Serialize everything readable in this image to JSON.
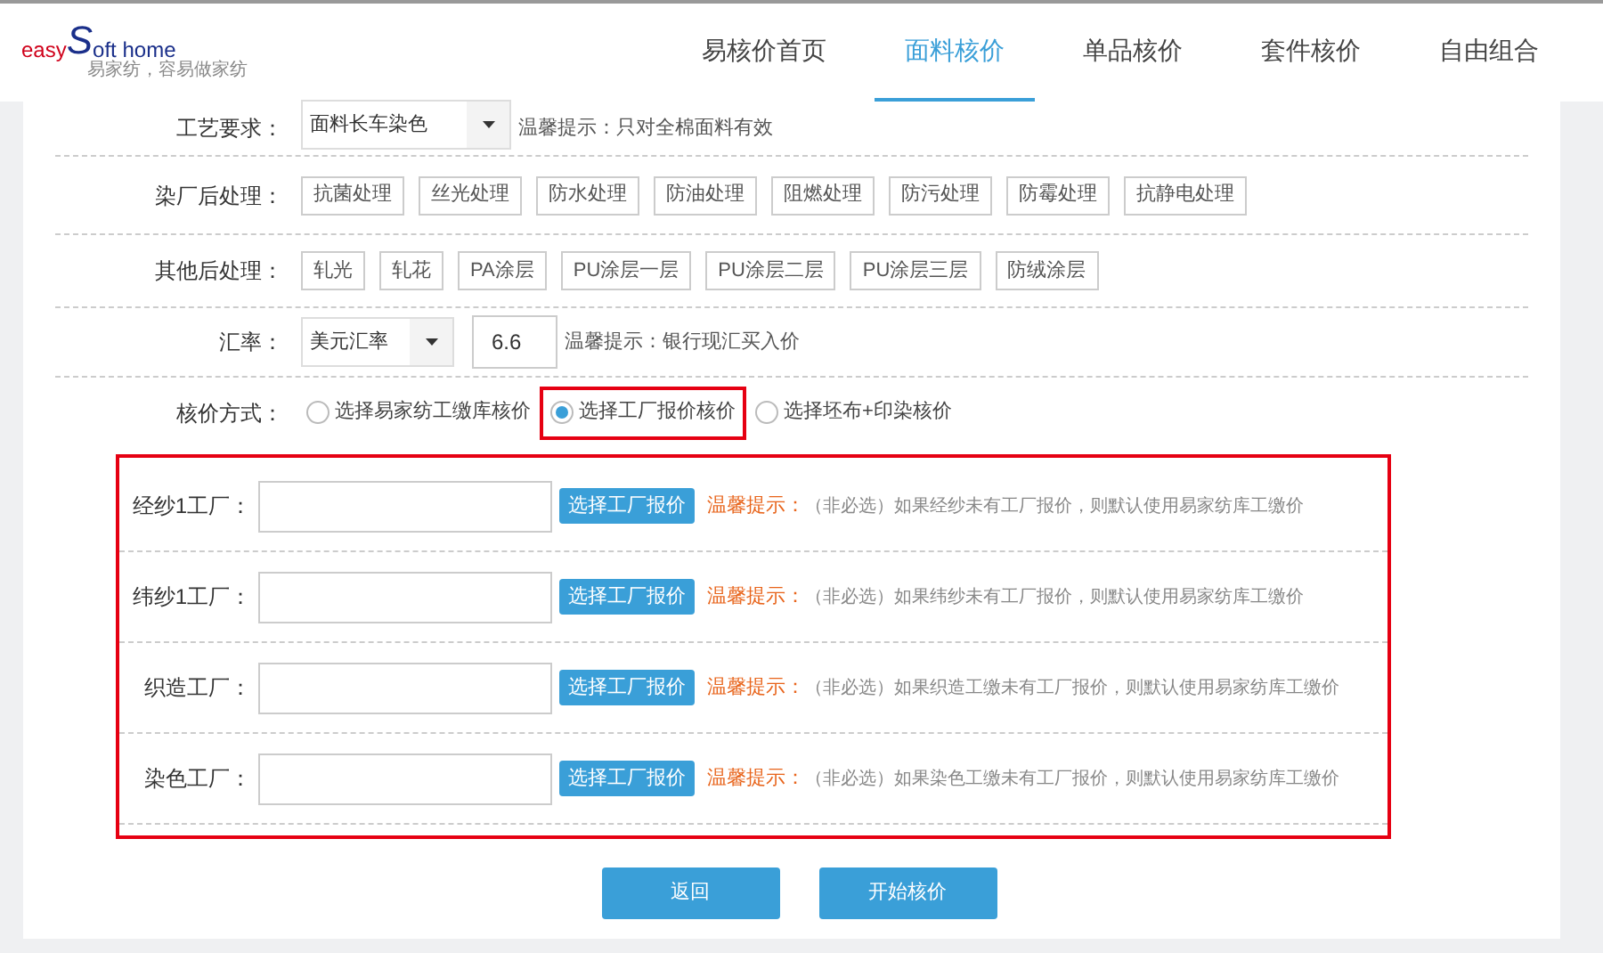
{
  "logo": {
    "word1": "easy",
    "letter": "S",
    "word2": "oft home",
    "tagline": "易家纺，容易做家纺"
  },
  "nav": [
    {
      "label": "易核价首页",
      "selected": false
    },
    {
      "label": "面料核价",
      "selected": true
    },
    {
      "label": "单品核价",
      "selected": false
    },
    {
      "label": "套件核价",
      "selected": false
    },
    {
      "label": "自由组合",
      "selected": false
    }
  ],
  "process": {
    "label": "工艺要求：",
    "value": "面料长车染色",
    "hint": "温馨提示：只对全棉面料有效"
  },
  "dye_finishing": {
    "label": "染厂后处理：",
    "options": [
      "抗菌处理",
      "丝光处理",
      "防水处理",
      "防油处理",
      "阻燃处理",
      "防污处理",
      "防霉处理",
      "抗静电处理"
    ]
  },
  "other_finishing": {
    "label": "其他后处理：",
    "options": [
      "轧光",
      "轧花",
      "PA涂层",
      "PU涂层一层",
      "PU涂层二层",
      "PU涂层三层",
      "防绒涂层"
    ]
  },
  "exchange": {
    "label": "汇率：",
    "currency": "美元汇率",
    "rate": "6.6",
    "hint": "温馨提示：银行现汇买入价"
  },
  "method": {
    "label": "核价方式：",
    "options": [
      {
        "label": "选择易家纺工缴库核价",
        "selected": false,
        "highlighted": false
      },
      {
        "label": "选择工厂报价核价",
        "selected": true,
        "highlighted": true
      },
      {
        "label": "选择坯布+印染核价",
        "selected": false,
        "highlighted": false
      }
    ]
  },
  "factories": {
    "highlighted": true,
    "rows": [
      {
        "label": "经纱1工厂：",
        "button": "选择工厂报价",
        "hint_title": "温馨提示：",
        "hint": "（非必选）如果经纱未有工厂报价，则默认使用易家纺库工缴价"
      },
      {
        "label": "纬纱1工厂：",
        "button": "选择工厂报价",
        "hint_title": "温馨提示：",
        "hint": "（非必选）如果纬纱未有工厂报价，则默认使用易家纺库工缴价"
      },
      {
        "label": "织造工厂：",
        "button": "选择工厂报价",
        "hint_title": "温馨提示：",
        "hint": "（非必选）如果织造工缴未有工厂报价，则默认使用易家纺库工缴价"
      },
      {
        "label": "染色工厂：",
        "button": "选择工厂报价",
        "hint_title": "温馨提示：",
        "hint": "（非必选）如果染色工缴未有工厂报价，则默认使用易家纺库工缴价"
      }
    ]
  },
  "actions": [
    "返回",
    "开始核价"
  ]
}
